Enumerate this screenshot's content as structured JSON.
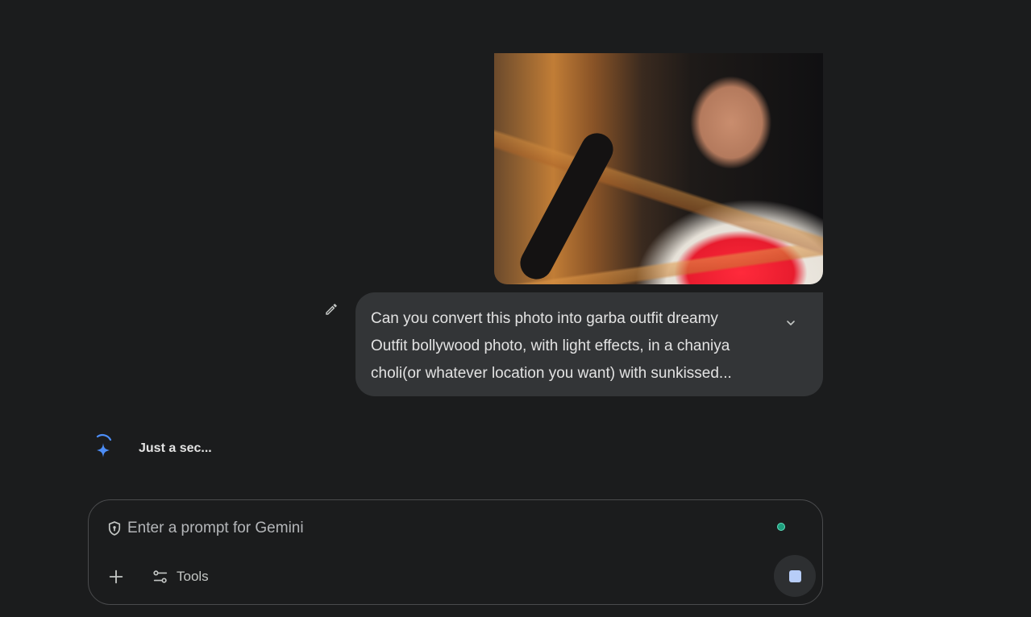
{
  "conversation": {
    "user_message": {
      "image": {
        "description_icon": "uploaded-photo"
      },
      "text": "Can you convert this photo into garba outfit dreamy\nOutfit bollywood photo, with light effects, in a chaniya\ncholi(or whatever location you want) with sunkissed...",
      "edit_icon": "pencil-icon",
      "expand_icon": "chevron-down-icon"
    },
    "model_response": {
      "status_text": "Just a sec...",
      "icon": "gemini-spark-icon"
    }
  },
  "prompt_bar": {
    "placeholder": "Enter a prompt for Gemini",
    "value": "",
    "shield_icon": "shield-icon",
    "add_icon": "plus-icon",
    "tools_label": "Tools",
    "tools_icon": "tune-icon",
    "stop_icon": "stop-icon"
  },
  "colors": {
    "background": "#1b1c1d",
    "bubble": "#333537",
    "accent_blue": "#4c8df6",
    "stop_square": "#b7cdf8",
    "status_dot": "#1e9e7d"
  }
}
